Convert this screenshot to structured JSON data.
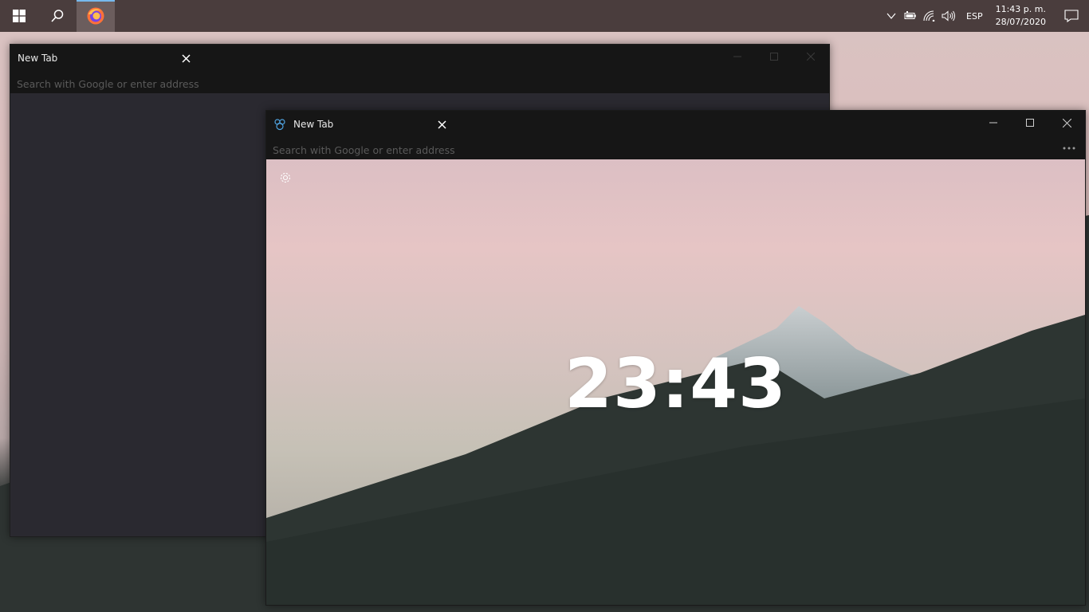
{
  "taskbar": {
    "start_icon": "windows-logo-icon",
    "search_icon": "search-icon",
    "pinned_app_icon": "firefox-icon",
    "tray": {
      "language": "ESP",
      "time": "11:43 p. m.",
      "date": "28/07/2020"
    }
  },
  "back_window": {
    "tab_title": "New Tab",
    "address_placeholder": "Search with Google or enter address"
  },
  "front_window": {
    "tab_title": "New Tab",
    "address_placeholder": "Search with Google or enter address",
    "clock": "23:43"
  },
  "colors": {
    "taskbar": "#4a3d3d",
    "titlebar": "#161616",
    "accent": "#76b9ed"
  }
}
